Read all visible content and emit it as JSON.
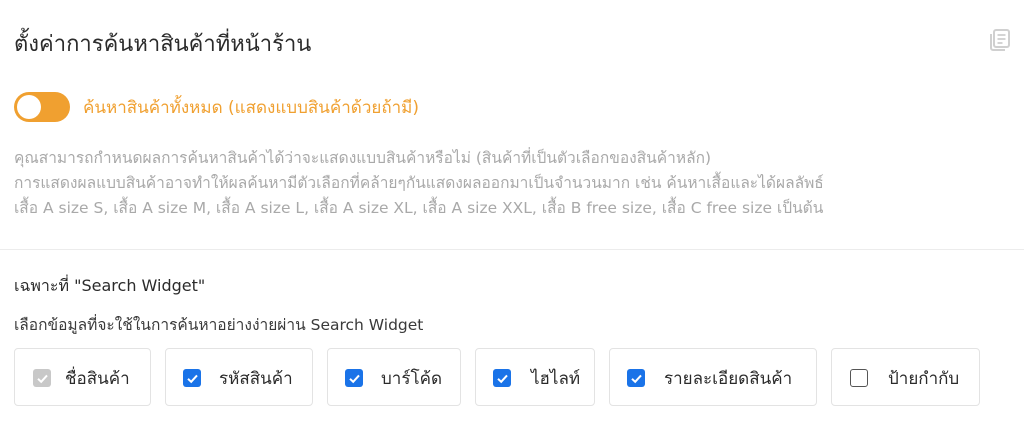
{
  "header": {
    "title": "ตั้งค่าการค้นหาสินค้าที่หน้าร้าน",
    "corner_icon": "document-copy-icon"
  },
  "toggle": {
    "state": "on",
    "color": "#f0a030",
    "label": "ค้นหาสินค้าทั้งหมด (แสดงแบบสินค้าด้วยถ้ามี)"
  },
  "description": {
    "lines": [
      "คุณสามารถกำหนดผลการค้นหาสินค้าได้ว่าจะแสดงแบบสินค้าหรือไม่ (สินค้าที่เป็นตัวเลือกของสินค้าหลัก)",
      "การแสดงผลแบบสินค้าอาจทำให้ผลค้นหามีตัวเลือกที่คล้ายๆกันแสดงผลออกมาเป็นจำนวนมาก เช่น ค้นหาเสื้อและได้ผลลัพธ์",
      "เสื้อ A size S, เสื้อ A size M, เสื้อ A size L, เสื้อ A size XL, เสื้อ A size XXL, เสื้อ B free size, เสื้อ C free size เป็นต้น"
    ]
  },
  "search_widget": {
    "title": "เฉพาะที่ \"Search Widget\"",
    "subtitle": "เลือกข้อมูลที่จะใช้ในการค้นหาอย่างง่ายผ่าน Search Widget",
    "accent": "#1a73e8",
    "options": [
      {
        "label": "ชื่อสินค้า",
        "state": "disabled"
      },
      {
        "label": "รหัสสินค้า",
        "state": "checked"
      },
      {
        "label": "บาร์โค้ด",
        "state": "checked"
      },
      {
        "label": "ไฮไลท์",
        "state": "checked"
      },
      {
        "label": "รายละเอียดสินค้า",
        "state": "checked"
      },
      {
        "label": "ป้ายกำกับ",
        "state": "unchecked"
      }
    ]
  }
}
